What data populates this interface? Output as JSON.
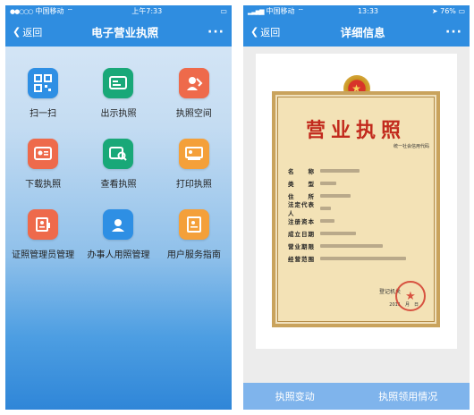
{
  "left": {
    "status": {
      "carrier": "中国移动",
      "time": "上午7:33"
    },
    "nav": {
      "back": "返回",
      "title": "电子营业执照",
      "more": "···"
    },
    "tiles": [
      {
        "label": "扫一扫",
        "icon": "qr-scan-icon",
        "color": "blue"
      },
      {
        "label": "出示执照",
        "icon": "present-license-icon",
        "color": "green"
      },
      {
        "label": "执照空间",
        "icon": "license-space-icon",
        "color": "red"
      },
      {
        "label": "下载执照",
        "icon": "download-license-icon",
        "color": "red"
      },
      {
        "label": "查看执照",
        "icon": "view-license-icon",
        "color": "green"
      },
      {
        "label": "打印执照",
        "icon": "print-license-icon",
        "color": "orange"
      },
      {
        "label": "证照管理员管理",
        "icon": "admin-manage-icon",
        "color": "red"
      },
      {
        "label": "办事人用照管理",
        "icon": "agent-manage-icon",
        "color": "blue"
      },
      {
        "label": "用户服务指南",
        "icon": "service-guide-icon",
        "color": "orange"
      }
    ]
  },
  "right": {
    "status": {
      "carrier": "中国移动",
      "time": "13:33",
      "battery": "76%"
    },
    "nav": {
      "back": "返回",
      "title": "详细信息",
      "more": "···"
    },
    "license": {
      "title": "营业执照",
      "code_label": "统一社会信用代码",
      "fields": [
        "名　　称",
        "类　　型",
        "住　　所",
        "法定代表人",
        "注册资本",
        "成立日期",
        "营业期限",
        "经营范围"
      ],
      "org": "登记机关",
      "date": "2011　月　日"
    },
    "bottom": {
      "left": "执照变动",
      "right": "执照领用情况"
    }
  }
}
